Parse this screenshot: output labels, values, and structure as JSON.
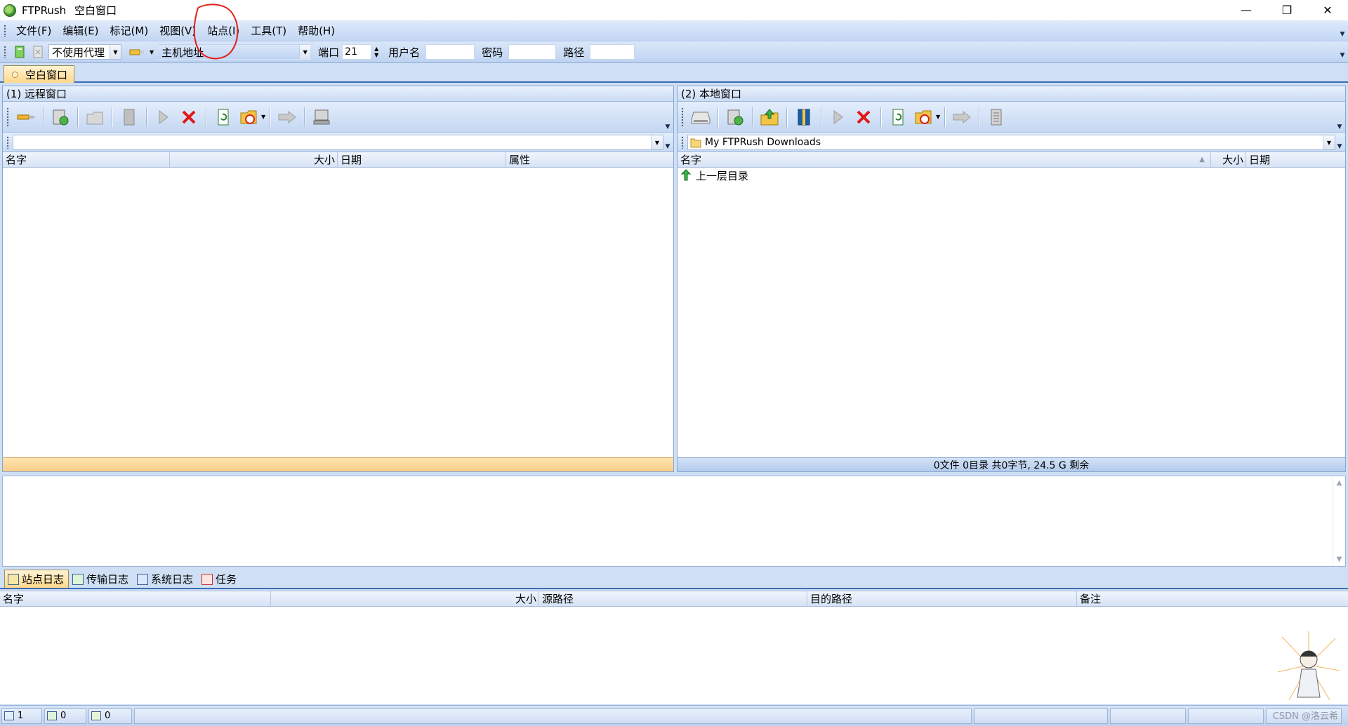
{
  "window": {
    "app_name": "FTPRush",
    "doc_title": "空白窗口",
    "controls": {
      "minimize": "—",
      "restore": "❐",
      "close": "✕"
    }
  },
  "menu": {
    "items": [
      "文件(F)",
      "编辑(E)",
      "标记(M)",
      "视图(V)",
      "站点(I)",
      "工具(T)",
      "帮助(H)"
    ],
    "highlighted_item": "站点(I)"
  },
  "quick_connect": {
    "proxy": "不使用代理",
    "host_placeholder": "主机地址",
    "port_label": "端口",
    "port_value": "21",
    "user_label": "用户名",
    "password_label": "密码",
    "path_label": "路径"
  },
  "doc_tab": {
    "label": "空白窗口"
  },
  "remote_panel": {
    "title": "(1) 远程窗口",
    "path": "",
    "columns": [
      "名字",
      "大小",
      "日期",
      "属性"
    ],
    "rows": [],
    "footer": ""
  },
  "local_panel": {
    "title": "(2) 本地窗口",
    "path": "My FTPRush Downloads",
    "columns": [
      "名字",
      "大小",
      "日期"
    ],
    "rows": [
      {
        "name": "上一层目录"
      }
    ],
    "footer": "0文件 0目录 共0字节, 24.5 G 剩余"
  },
  "log_tabs": [
    "站点日志",
    "传输日志",
    "系统日志",
    "任务"
  ],
  "active_log_tab": "站点日志",
  "queue": {
    "columns": [
      "名字",
      "大小",
      "源路径",
      "目的路径",
      "备注"
    ]
  },
  "status_bar": {
    "windows_count": "1",
    "queue_count": "0",
    "done_count": "0"
  },
  "watermark": "CSDN @洛云希",
  "colors": {
    "accent": "#3d6cb3",
    "tab_active": "#ffd88a",
    "annotation": "#e0201a"
  }
}
